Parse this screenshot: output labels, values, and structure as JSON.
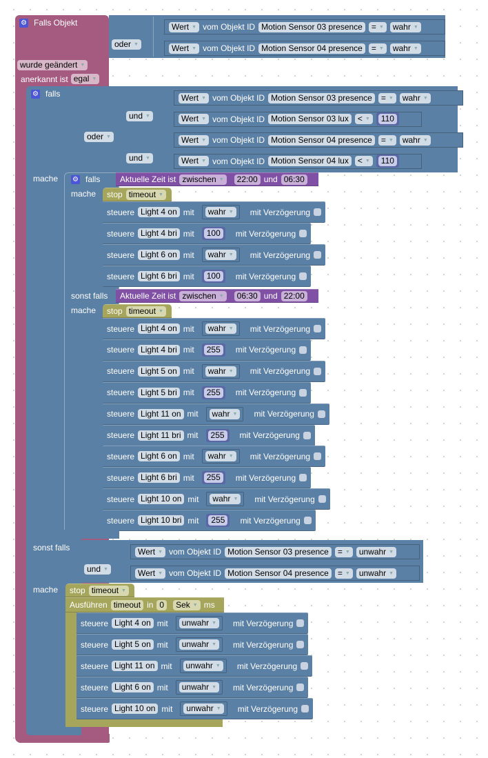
{
  "trigger": {
    "title": "Falls Objekt",
    "operator": "oder",
    "conditions": [
      {
        "mode": "Wert",
        "of_object": "vom Objekt ID",
        "object": "Motion Sensor 03 presence",
        "cmp": "=",
        "value": "wahr"
      },
      {
        "mode": "Wert",
        "of_object": "vom Objekt ID",
        "object": "Motion Sensor 04 presence",
        "cmp": "=",
        "value": "wahr"
      }
    ],
    "event": "wurde geändert",
    "ack_label": "anerkannt ist",
    "ack_value": "egal"
  },
  "if_block": {
    "falls": "falls",
    "outer_op": "oder",
    "groups": [
      {
        "op": "und",
        "conditions": [
          {
            "mode": "Wert",
            "of_object": "vom Objekt ID",
            "object": "Motion Sensor 03 presence",
            "cmp": "=",
            "value": "wahr"
          },
          {
            "mode": "Wert",
            "of_object": "vom Objekt ID",
            "object": "Motion Sensor 03 lux",
            "cmp": "<",
            "value": "110"
          }
        ]
      },
      {
        "op": "und",
        "conditions": [
          {
            "mode": "Wert",
            "of_object": "vom Objekt ID",
            "object": "Motion Sensor 04 presence",
            "cmp": "=",
            "value": "wahr"
          },
          {
            "mode": "Wert",
            "of_object": "vom Objekt ID",
            "object": "Motion Sensor 04 lux",
            "cmp": "<",
            "value": "110"
          }
        ]
      }
    ],
    "mache": "mache",
    "sonst_falls": "sonst falls"
  },
  "inner_if": {
    "falls": "falls",
    "mache": "mache",
    "sonst_falls": "sonst falls",
    "time1": {
      "label": "Aktuelle Zeit ist",
      "mode": "zwischen",
      "from": "22:00",
      "and": "und",
      "to": "06:30"
    },
    "time2": {
      "label": "Aktuelle Zeit ist",
      "mode": "zwischen",
      "from": "06:30",
      "and": "und",
      "to": "22:00"
    },
    "stop": {
      "label": "stop",
      "timer": "timeout"
    },
    "branch1": [
      {
        "verb": "steuere",
        "target": "Light 4 on",
        "mit": "mit",
        "value": "wahr",
        "kind": "bool",
        "delay": "mit Verzögerung"
      },
      {
        "verb": "steuere",
        "target": "Light 4 bri",
        "mit": "mit",
        "value": "100",
        "kind": "num",
        "delay": "mit Verzögerung"
      },
      {
        "verb": "steuere",
        "target": "Light 6 on",
        "mit": "mit",
        "value": "wahr",
        "kind": "bool",
        "delay": "mit Verzögerung"
      },
      {
        "verb": "steuere",
        "target": "Light 6 bri",
        "mit": "mit",
        "value": "100",
        "kind": "num",
        "delay": "mit Verzögerung"
      }
    ],
    "branch2": [
      {
        "verb": "steuere",
        "target": "Light 4 on",
        "mit": "mit",
        "value": "wahr",
        "kind": "bool",
        "delay": "mit Verzögerung"
      },
      {
        "verb": "steuere",
        "target": "Light 4 bri",
        "mit": "mit",
        "value": "255",
        "kind": "num",
        "delay": "mit Verzögerung"
      },
      {
        "verb": "steuere",
        "target": "Light 5 on",
        "mit": "mit",
        "value": "wahr",
        "kind": "bool",
        "delay": "mit Verzögerung"
      },
      {
        "verb": "steuere",
        "target": "Light 5 bri",
        "mit": "mit",
        "value": "255",
        "kind": "num",
        "delay": "mit Verzögerung"
      },
      {
        "verb": "steuere",
        "target": "Light 11 on",
        "mit": "mit",
        "value": "wahr",
        "kind": "bool",
        "delay": "mit Verzögerung"
      },
      {
        "verb": "steuere",
        "target": "Light 11 bri",
        "mit": "mit",
        "value": "255",
        "kind": "num",
        "delay": "mit Verzögerung"
      },
      {
        "verb": "steuere",
        "target": "Light 6 on",
        "mit": "mit",
        "value": "wahr",
        "kind": "bool",
        "delay": "mit Verzögerung"
      },
      {
        "verb": "steuere",
        "target": "Light 6 bri",
        "mit": "mit",
        "value": "255",
        "kind": "num",
        "delay": "mit Verzögerung"
      },
      {
        "verb": "steuere",
        "target": "Light 10 on",
        "mit": "mit",
        "value": "wahr",
        "kind": "bool",
        "delay": "mit Verzögerung"
      },
      {
        "verb": "steuere",
        "target": "Light 10 bri",
        "mit": "mit",
        "value": "255",
        "kind": "num",
        "delay": "mit Verzögerung"
      }
    ]
  },
  "else_if": {
    "label": "sonst falls",
    "op": "und",
    "conditions": [
      {
        "mode": "Wert",
        "of_object": "vom Objekt ID",
        "object": "Motion Sensor 03 presence",
        "cmp": "=",
        "value": "unwahr"
      },
      {
        "mode": "Wert",
        "of_object": "vom Objekt ID",
        "object": "Motion Sensor 04 presence",
        "cmp": "=",
        "value": "unwahr"
      }
    ],
    "mache": "mache",
    "stop": {
      "label": "stop",
      "timer": "timeout"
    },
    "timeout": {
      "label": "Ausführen",
      "timer": "timeout",
      "in": "in",
      "value": "0",
      "unit": "Sek",
      "ms": "ms"
    },
    "actions": [
      {
        "verb": "steuere",
        "target": "Light 4 on",
        "mit": "mit",
        "value": "unwahr",
        "kind": "bool",
        "delay": "mit Verzögerung"
      },
      {
        "verb": "steuere",
        "target": "Light 5 on",
        "mit": "mit",
        "value": "unwahr",
        "kind": "bool",
        "delay": "mit Verzögerung"
      },
      {
        "verb": "steuere",
        "target": "Light 11 on",
        "mit": "mit",
        "value": "unwahr",
        "kind": "bool",
        "delay": "mit Verzögerung"
      },
      {
        "verb": "steuere",
        "target": "Light 6 on",
        "mit": "mit",
        "value": "unwahr",
        "kind": "bool",
        "delay": "mit Verzögerung"
      },
      {
        "verb": "steuere",
        "target": "Light 10 on",
        "mit": "mit",
        "value": "unwahr",
        "kind": "bool",
        "delay": "mit Verzögerung"
      }
    ]
  },
  "icons": {
    "gear": "⚙",
    "dropdown": "▼"
  }
}
